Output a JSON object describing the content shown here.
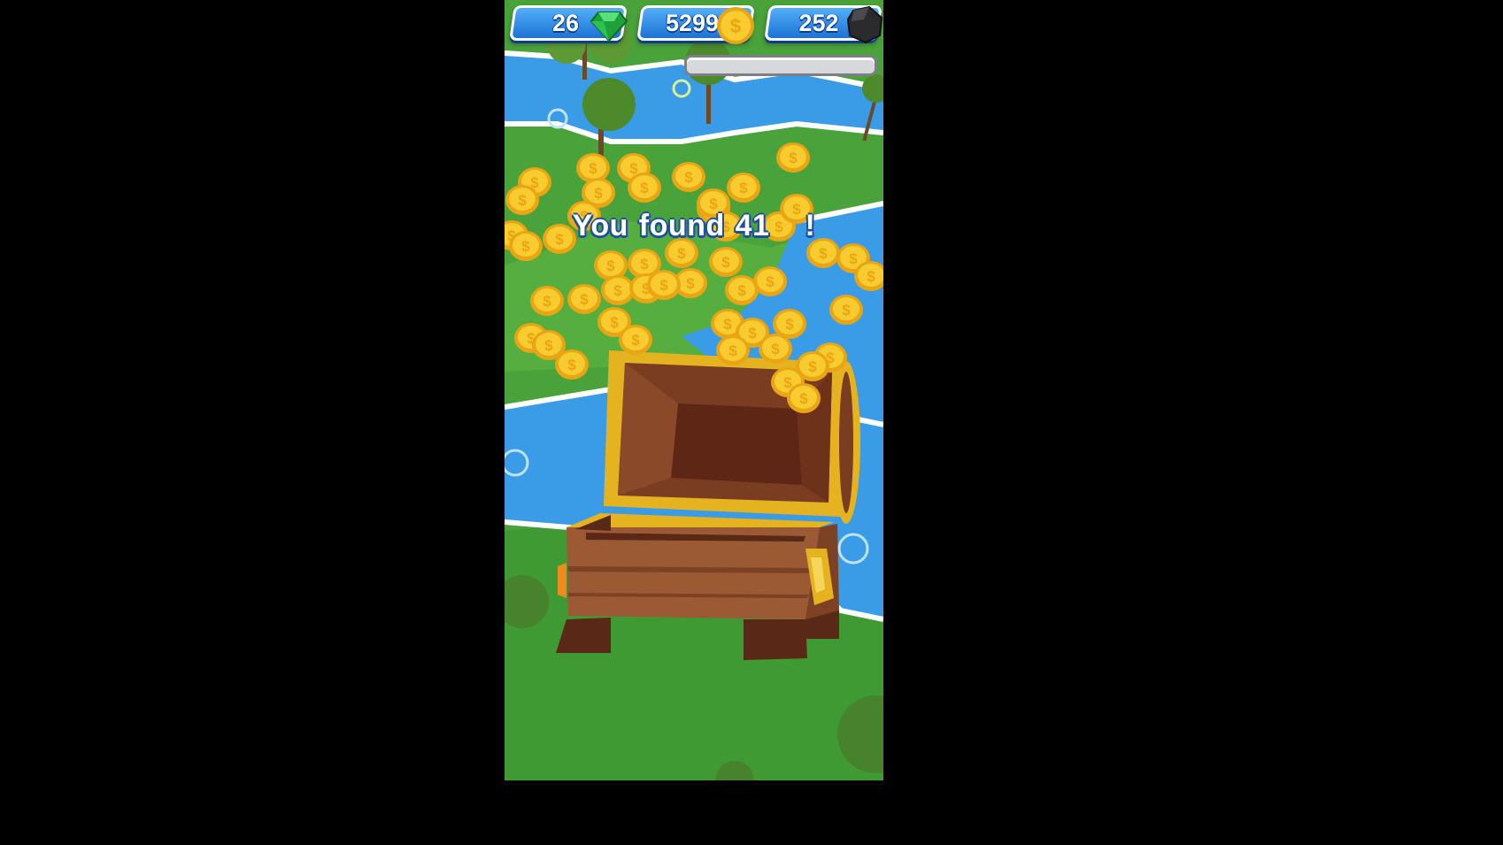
{
  "hud": {
    "gems": {
      "value": "26",
      "icon": "green-gem-icon",
      "color": "#2bb54a"
    },
    "coins": {
      "value": "5299",
      "icon": "gold-coin-icon",
      "color": "#f5b81c"
    },
    "coal": {
      "value": "252",
      "icon": "coal-icon",
      "color": "#2b2b2e"
    }
  },
  "progress": {
    "fraction": 0
  },
  "reward": {
    "text_before": "You found 41",
    "text_after": "!",
    "reward_icon": "gold-coin-icon"
  },
  "scene": {
    "object": "treasure-chest",
    "background": "grass-river",
    "colors": {
      "grass": "#4aa23a",
      "river": "#3a9be6",
      "coin": "#f5b81c",
      "wood": "#8b4f2a",
      "gold_trim": "#e8b21e"
    }
  }
}
